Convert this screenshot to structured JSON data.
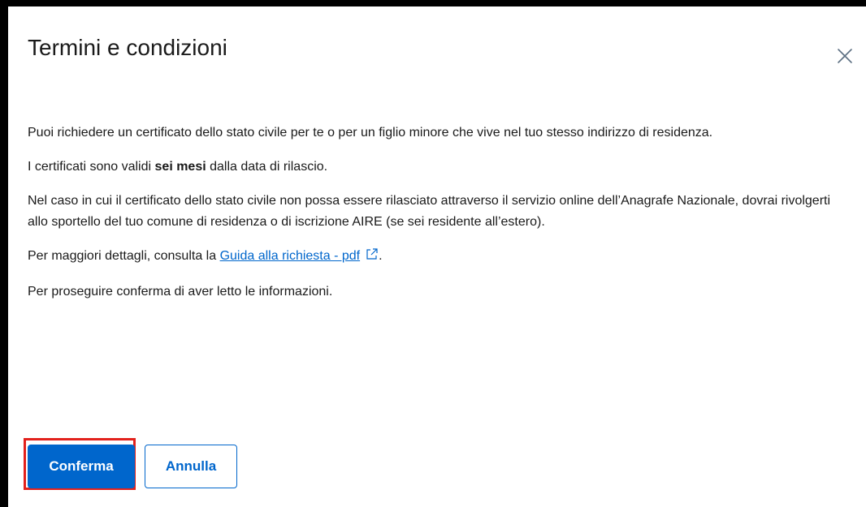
{
  "modal": {
    "title": "Termini e condizioni",
    "close_icon": "close-icon"
  },
  "body": {
    "p1": "Puoi richiedere un certificato dello stato civile per te o per un figlio minore che vive nel tuo stesso indirizzo di residenza.",
    "p2_before": "I certificati sono validi ",
    "p2_bold": "sei mesi",
    "p2_after": " dalla data di rilascio.",
    "p3": "Nel caso in cui il certificato dello stato civile non possa essere rilasciato attraverso il servizio online dell’Anagrafe Nazionale, dovrai rivolgerti allo sportello del tuo comune di residenza o di iscrizione AIRE (se sei residente all’estero).",
    "p4_before": "Per maggiori dettagli, consulta la ",
    "p4_link": "Guida alla richiesta - pdf",
    "p4_link_icon": "external-link-icon",
    "p4_after": ".",
    "p5": "Per proseguire conferma di aver letto le informazioni."
  },
  "footer": {
    "confirm_label": "Conferma",
    "cancel_label": "Annulla"
  },
  "colors": {
    "primary": "#0066cc",
    "highlight": "#e2211c",
    "text": "#1a1a1a",
    "backdrop": "#000000"
  }
}
